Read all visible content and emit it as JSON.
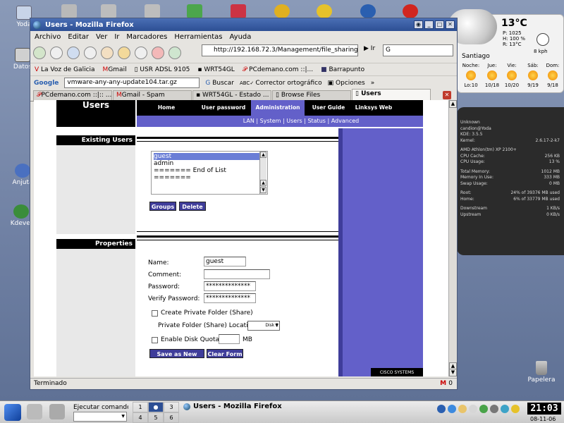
{
  "desktop": {
    "icons": [
      {
        "label": "Yoda"
      },
      {
        "label": "Datos"
      },
      {
        "label": "Anjuta"
      },
      {
        "label": "Kdevel"
      }
    ],
    "trash_label": "Papelera"
  },
  "weather": {
    "temp": "13°C",
    "details": [
      "P: 1025",
      "H: 100 %",
      "R: 13°C"
    ],
    "wind": "8 kph",
    "city": "Santiago",
    "forecast": [
      {
        "day": "Noche:",
        "temps": "Lo:10"
      },
      {
        "day": "Jue:",
        "temps": "10/18"
      },
      {
        "day": "Vie:",
        "temps": "10/20"
      },
      {
        "day": "Sáb:",
        "temps": "9/19"
      },
      {
        "day": "Dom:",
        "temps": "9/18"
      }
    ]
  },
  "sysmon": {
    "rows": [
      [
        "Unknown",
        ""
      ],
      [
        "candion@Yoda",
        ""
      ],
      [
        "KDE: 3.5.5",
        ""
      ],
      [
        "Kernel:",
        "2.6.17-2-k7"
      ],
      [
        "",
        ""
      ],
      [
        "AMD Athlon(tm) XP 2100+",
        ""
      ],
      [
        "CPU Cache:",
        "256 KB"
      ],
      [
        "CPU Usage:",
        "13 %"
      ],
      [
        "",
        ""
      ],
      [
        "Total Memory:",
        "1012 MB"
      ],
      [
        "Memory In Use:",
        "333 MB"
      ],
      [
        "Swap Usage:",
        "0 MB"
      ],
      [
        "",
        ""
      ],
      [
        "Root:",
        "24% of 39376 MB used"
      ],
      [
        "Home:",
        "6% of 33779 MB used"
      ],
      [
        "",
        ""
      ],
      [
        "Downstream",
        "1 KB/s"
      ],
      [
        "Upstream",
        "0 KB/s"
      ]
    ]
  },
  "window": {
    "title": "Users - Mozilla Firefox",
    "menu": [
      "Archivo",
      "Editar",
      "Ver",
      "Ir",
      "Marcadores",
      "Herramientas",
      "Ayuda"
    ],
    "url": "http://192.168.72.3/Management/file_sharing",
    "go_label": "Ir",
    "search_value": "G",
    "bookmarks": [
      "La Voz de Galicia",
      "Gmail",
      "USR ADSL 9105",
      "WRT54GL",
      "PCdemano.com ::|...",
      "Barrapunto"
    ],
    "google_toolbar": {
      "brand": "Google",
      "query": "vmware-any-any-update104.tar.gz",
      "search": "Buscar",
      "speller": "Corrector ortográfico",
      "options": "Opciones",
      "more": "»"
    },
    "tabs": [
      {
        "label": "PCdemano.com ::|:: ..."
      },
      {
        "label": "Gmail - Spam"
      },
      {
        "label": "WRT54GL - Estado ..."
      },
      {
        "label": "Browse Files"
      },
      {
        "label": "Users"
      }
    ],
    "status": "Terminado",
    "status_mail": "0"
  },
  "page": {
    "heading": "Users",
    "nav": [
      "Home",
      "User password",
      "Administration",
      "User Guide",
      "Linksys Web"
    ],
    "subnav": "LAN | System | Users | Status | Advanced",
    "existing_users_label": "Existing Users",
    "users": [
      "guest",
      "admin",
      "======= End of List ======="
    ],
    "groups_btn": "Groups",
    "delete_btn": "Delete",
    "properties_label": "Properties",
    "form": {
      "name_label": "Name:",
      "name_value": "guest",
      "comment_label": "Comment:",
      "comment_value": "",
      "password_label": "Password:",
      "password_value": "**************",
      "verify_label": "Verify Password:",
      "verify_value": "**************",
      "private_folder_label": "Create Private Folder (Share)",
      "location_label": "Private Folder (Share) Location:",
      "location_value": "Disk 2",
      "quota_label": "Enable Disk Quota of",
      "quota_unit": "MB",
      "save_btn": "Save as New User",
      "clear_btn": "Clear Form"
    },
    "brand": "CISCO SYSTEMS"
  },
  "taskbar": {
    "exec_label": "Ejecutar comando",
    "pager": [
      "1",
      "2",
      "3",
      "4",
      "5",
      "6"
    ],
    "current_desktop": "2",
    "task": "Users - Mozilla Firefox",
    "clock": "21:03",
    "date": "08-11-06"
  }
}
